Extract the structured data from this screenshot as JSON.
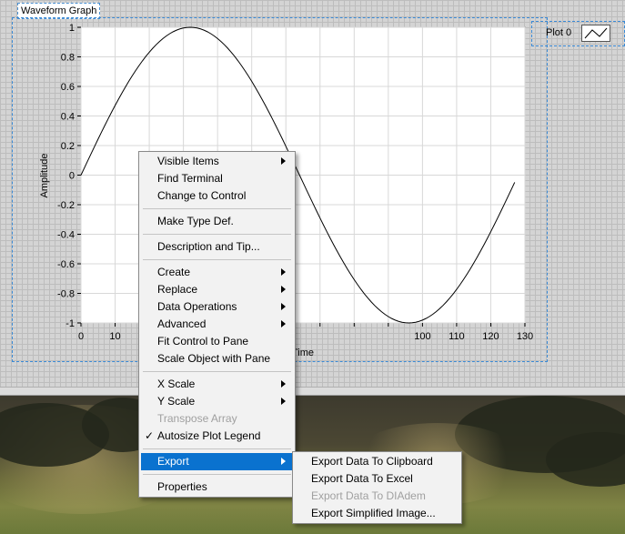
{
  "graph": {
    "title": "Waveform Graph",
    "legend_plot_name": "Plot 0",
    "x_axis_label": "Time",
    "y_axis_label": "Amplitude"
  },
  "chart_data": {
    "type": "line",
    "xlabel": "Time",
    "ylabel": "Amplitude",
    "xlim": [
      0,
      130
    ],
    "ylim": [
      -1,
      1
    ],
    "x_ticks": [
      0,
      10,
      20,
      30,
      40,
      50,
      60,
      70,
      80,
      90,
      100,
      110,
      120,
      130
    ],
    "x_tick_labels": [
      "0",
      "10",
      "",
      "",
      "",
      "",
      "",
      "",
      "",
      "",
      "100",
      "110",
      "120",
      "130"
    ],
    "y_ticks": [
      1,
      0.8,
      0.6,
      0.4,
      0.2,
      0,
      -0.2,
      -0.4,
      -0.6,
      -0.8,
      -1
    ],
    "y_tick_labels": [
      "1",
      "0.8",
      "0.6",
      "0.4",
      "0.2",
      "0",
      "-0.2",
      "-0.4",
      "-0.6",
      "-0.8",
      "-1"
    ],
    "grid": true,
    "series": [
      {
        "name": "Plot 0",
        "function": "sin",
        "period": 128,
        "x_start": 0,
        "x_end": 127,
        "points": 128
      }
    ]
  },
  "context_menu": {
    "items": [
      {
        "label": "Visible Items",
        "submenu": true
      },
      {
        "label": "Find Terminal"
      },
      {
        "label": "Change to Control"
      },
      {
        "separator": true
      },
      {
        "label": "Make Type Def."
      },
      {
        "separator": true
      },
      {
        "label": "Description and Tip..."
      },
      {
        "separator": true
      },
      {
        "label": "Create",
        "submenu": true
      },
      {
        "label": "Replace",
        "submenu": true
      },
      {
        "label": "Data Operations",
        "submenu": true
      },
      {
        "label": "Advanced",
        "submenu": true
      },
      {
        "label": "Fit Control to Pane"
      },
      {
        "label": "Scale Object with Pane"
      },
      {
        "separator": true
      },
      {
        "label": "X Scale",
        "submenu": true
      },
      {
        "label": "Y Scale",
        "submenu": true
      },
      {
        "label": "Transpose Array",
        "disabled": true
      },
      {
        "label": "Autosize Plot Legend",
        "checked": true
      },
      {
        "separator": true
      },
      {
        "label": "Export",
        "submenu": true,
        "highlighted": true
      },
      {
        "separator": true
      },
      {
        "label": "Properties"
      }
    ]
  },
  "export_submenu": {
    "items": [
      {
        "label": "Export Data To Clipboard"
      },
      {
        "label": "Export Data To Excel"
      },
      {
        "label": "Export Data To DIAdem",
        "disabled": true
      },
      {
        "label": "Export Simplified Image..."
      }
    ]
  },
  "colors": {
    "highlight": "#0a72cf",
    "selection_outline": "#3a8ad6",
    "plot_line": "#000000"
  },
  "icons": {
    "submenu_arrow": "chevron-right-icon",
    "check": "check-icon",
    "legend_swatch": "line-plot-icon"
  }
}
